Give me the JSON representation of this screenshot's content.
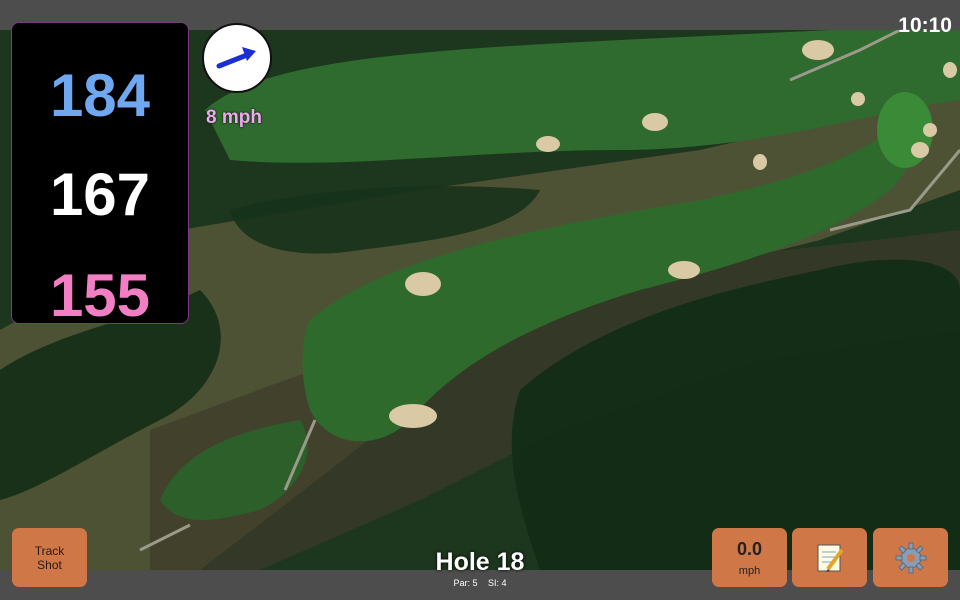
{
  "status": {
    "time": "10:10"
  },
  "distances": {
    "back": "184",
    "middle": "167",
    "front": "155"
  },
  "wind": {
    "speed": "8 mph",
    "arrow_icon": "arrow-right-icon"
  },
  "hole": {
    "title": "Hole 18",
    "par": "Par: 5",
    "stroke_index": "SI: 4"
  },
  "buttons": {
    "track_line1": "Track",
    "track_line2": "Shot",
    "speed_value": "0.0",
    "speed_unit": "mph",
    "notes_icon": "notepad-icon",
    "settings_icon": "gear-icon"
  },
  "colors": {
    "back": "#6fa8f0",
    "middle": "#ffffff",
    "front": "#f27fc4",
    "button": "#d07748",
    "wind_text": "#f0a8f0"
  }
}
